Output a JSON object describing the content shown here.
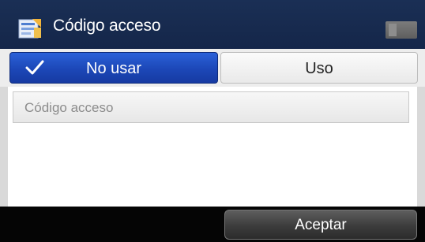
{
  "header": {
    "title": "Código acceso",
    "icon": "settings-icon"
  },
  "toggle": {
    "no_usar_label": "No usar",
    "uso_label": "Uso",
    "selected": "No usar",
    "check_icon": "check-icon"
  },
  "code_field": {
    "placeholder": "Código acceso"
  },
  "footer": {
    "aceptar_label": "Aceptar"
  },
  "colors": {
    "header_bg": "#172a4e",
    "selected_button": "#1c47b7",
    "footer_bg": "#050505"
  }
}
